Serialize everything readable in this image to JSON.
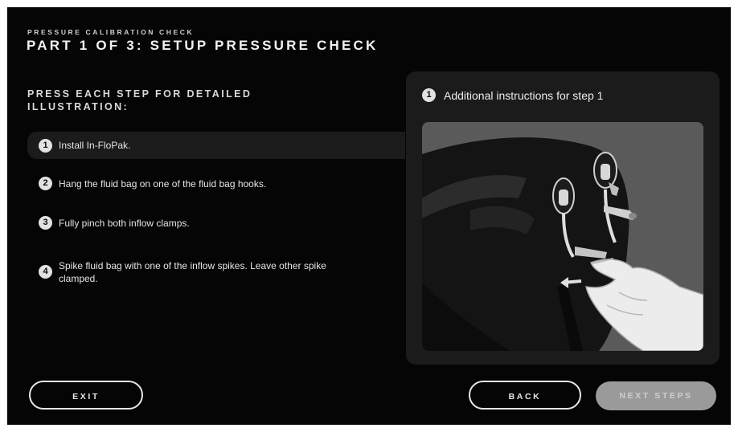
{
  "header": {
    "subtitle": "PRESSURE CALIBRATION CHECK",
    "title": "PART 1 OF 3: SETUP PRESSURE CHECK"
  },
  "instructions": {
    "heading": "PRESS EACH STEP FOR DETAILED ILLUSTRATION:"
  },
  "steps": [
    {
      "number": "1",
      "text": "Install In-FloPak.",
      "active": true
    },
    {
      "number": "2",
      "text": "Hang the fluid bag on one of the fluid bag hooks.",
      "active": false
    },
    {
      "number": "3",
      "text": "Fully pinch both inflow clamps.",
      "active": false
    },
    {
      "number": "4",
      "text": "Spike fluid bag with one of the inflow spikes. Leave other spike clamped.",
      "active": false
    }
  ],
  "detail_panel": {
    "step_number": "1",
    "title": "Additional instructions for step 1"
  },
  "buttons": {
    "exit": "EXIT",
    "back": "BACK",
    "next": "NEXT STEPS"
  },
  "colors": {
    "background": "#050505",
    "panel": "#1b1b1b",
    "text": "#e4e4e4",
    "disabled_button": "#9a9a9a"
  }
}
